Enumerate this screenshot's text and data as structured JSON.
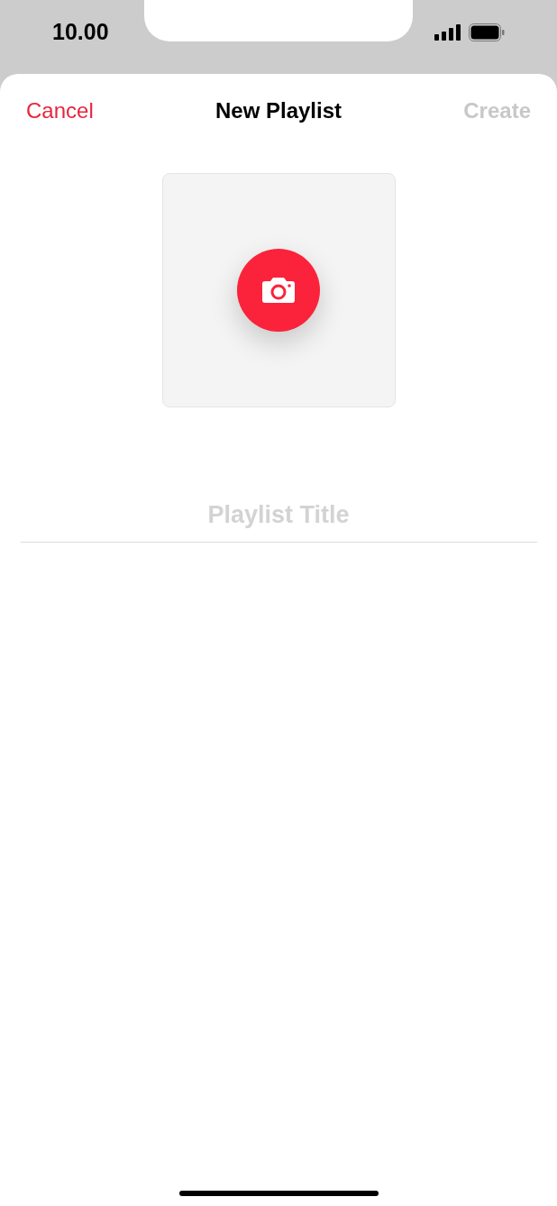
{
  "status_bar": {
    "time": "10.00"
  },
  "nav": {
    "cancel": "Cancel",
    "title": "New Playlist",
    "create": {
      "label": "Create",
      "disabled": true
    }
  },
  "title_field": {
    "placeholder": "Playlist Title"
  }
}
